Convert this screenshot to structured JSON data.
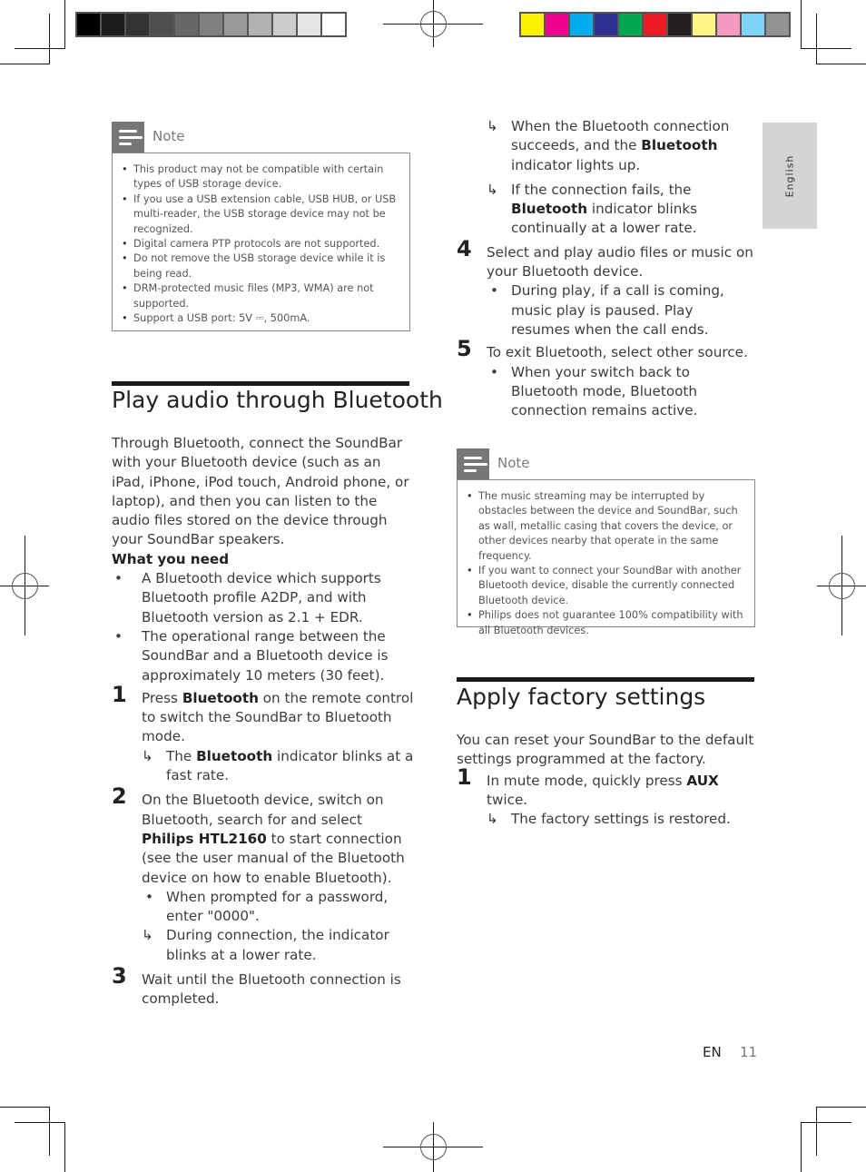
{
  "color_bar_gray": [
    "#000000",
    "#1c1c1c",
    "#333333",
    "#4f4f4f",
    "#676767",
    "#808080",
    "#999999",
    "#b2b2b2",
    "#cccccc",
    "#e5e5e5",
    "#ffffff"
  ],
  "color_bar_cmyk": [
    "#fff200",
    "#ec008c",
    "#00aeef",
    "#2e3192",
    "#00a651",
    "#ed1c24",
    "#231f20",
    "#fff685",
    "#f49ac1",
    "#7fd3f7",
    "#929292"
  ],
  "side_tab": {
    "label": "English"
  },
  "left_note": {
    "title": "Note",
    "items": [
      "This product may not be compatible with certain types of USB storage device.",
      "If you use a USB extension cable, USB HUB, or USB multi-reader, the USB storage device may not be recognized.",
      "Digital camera PTP protocols are not supported.",
      "Do not remove the USB storage device while it is being read.",
      "DRM-protected music files (MP3, WMA) are not supported.",
      "Support a USB port: 5V ⎓, 500mA."
    ]
  },
  "bluetooth_section": {
    "title": "Play audio through Bluetooth",
    "intro": "Through Bluetooth, connect the SoundBar with your Bluetooth device (such as an iPad, iPhone, iPod touch, Android phone, or laptop), and then you can listen to the audio files stored on the device through your SoundBar speakers.",
    "what_you_need_label": "What you need",
    "requirements": [
      "A Bluetooth device which supports Bluetooth profile A2DP, and with Bluetooth version as 2.1 + EDR.",
      "The operational range between the SoundBar and a Bluetooth device is approximately 10 meters (30 feet)."
    ],
    "step1": {
      "num": "1",
      "pre": "Press ",
      "bold": "Bluetooth",
      "post": " on the remote control to switch the SoundBar to Bluetooth mode.",
      "result_pre": "The ",
      "result_bold": "Bluetooth",
      "result_post": " indicator blinks at a fast rate."
    },
    "step2": {
      "num": "2",
      "pre": "On the Bluetooth device, switch on Bluetooth, search for and select ",
      "bold": "Philips HTL2160",
      "post": " to start connection (see the user manual of the Bluetooth device on how to enable Bluetooth).",
      "bullet": "When prompted for a password, enter \"0000\".",
      "result": "During connection, the indicator blinks at a lower rate."
    },
    "step3": {
      "num": "3",
      "text": "Wait until the Bluetooth connection is completed.",
      "result1_pre": "When the Bluetooth connection succeeds, and the ",
      "result1_bold": "Bluetooth",
      "result1_post": " indicator lights up.",
      "result2_pre": "If the connection fails, the ",
      "result2_bold": "Bluetooth",
      "result2_post": " indicator blinks continually at a lower rate."
    },
    "step4": {
      "num": "4",
      "text": "Select and play audio files or music on your Bluetooth device.",
      "bullet": "During play, if a call is coming, music play is paused. Play resumes when the call ends."
    },
    "step5": {
      "num": "5",
      "text": "To exit Bluetooth, select other source.",
      "bullet": "When your switch back to Bluetooth mode, Bluetooth connection remains active."
    }
  },
  "right_note": {
    "title": "Note",
    "items": [
      "The music streaming may be interrupted by obstacles between the device and SoundBar, such as wall, metallic casing that covers the device, or other devices nearby that operate in the same frequency.",
      "If you want to connect your SoundBar with another Bluetooth device, disable the currently connected Bluetooth device.",
      "Philips does not guarantee 100% compatibility with all Bluetooth devices."
    ]
  },
  "factory_section": {
    "title": "Apply factory settings",
    "intro": "You can reset your SoundBar to the default settings programmed at the factory.",
    "step1": {
      "num": "1",
      "pre": "In mute mode, quickly press ",
      "bold": "AUX",
      "post": " twice.",
      "result": "The factory settings is restored."
    }
  },
  "footer": {
    "lang": "EN",
    "page": "11"
  },
  "glyphs": {
    "arrow": "↳",
    "bullet": "•"
  }
}
